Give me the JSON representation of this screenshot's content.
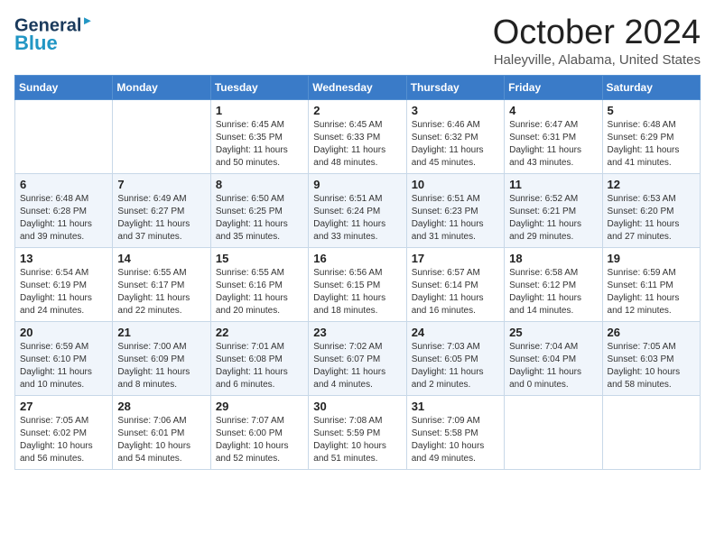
{
  "header": {
    "logo_line1": "General",
    "logo_line2": "Blue",
    "month_title": "October 2024",
    "location": "Haleyville, Alabama, United States"
  },
  "days_of_week": [
    "Sunday",
    "Monday",
    "Tuesday",
    "Wednesday",
    "Thursday",
    "Friday",
    "Saturday"
  ],
  "weeks": [
    [
      {
        "num": "",
        "sunrise": "",
        "sunset": "",
        "daylight": ""
      },
      {
        "num": "",
        "sunrise": "",
        "sunset": "",
        "daylight": ""
      },
      {
        "num": "1",
        "sunrise": "Sunrise: 6:45 AM",
        "sunset": "Sunset: 6:35 PM",
        "daylight": "Daylight: 11 hours and 50 minutes."
      },
      {
        "num": "2",
        "sunrise": "Sunrise: 6:45 AM",
        "sunset": "Sunset: 6:33 PM",
        "daylight": "Daylight: 11 hours and 48 minutes."
      },
      {
        "num": "3",
        "sunrise": "Sunrise: 6:46 AM",
        "sunset": "Sunset: 6:32 PM",
        "daylight": "Daylight: 11 hours and 45 minutes."
      },
      {
        "num": "4",
        "sunrise": "Sunrise: 6:47 AM",
        "sunset": "Sunset: 6:31 PM",
        "daylight": "Daylight: 11 hours and 43 minutes."
      },
      {
        "num": "5",
        "sunrise": "Sunrise: 6:48 AM",
        "sunset": "Sunset: 6:29 PM",
        "daylight": "Daylight: 11 hours and 41 minutes."
      }
    ],
    [
      {
        "num": "6",
        "sunrise": "Sunrise: 6:48 AM",
        "sunset": "Sunset: 6:28 PM",
        "daylight": "Daylight: 11 hours and 39 minutes."
      },
      {
        "num": "7",
        "sunrise": "Sunrise: 6:49 AM",
        "sunset": "Sunset: 6:27 PM",
        "daylight": "Daylight: 11 hours and 37 minutes."
      },
      {
        "num": "8",
        "sunrise": "Sunrise: 6:50 AM",
        "sunset": "Sunset: 6:25 PM",
        "daylight": "Daylight: 11 hours and 35 minutes."
      },
      {
        "num": "9",
        "sunrise": "Sunrise: 6:51 AM",
        "sunset": "Sunset: 6:24 PM",
        "daylight": "Daylight: 11 hours and 33 minutes."
      },
      {
        "num": "10",
        "sunrise": "Sunrise: 6:51 AM",
        "sunset": "Sunset: 6:23 PM",
        "daylight": "Daylight: 11 hours and 31 minutes."
      },
      {
        "num": "11",
        "sunrise": "Sunrise: 6:52 AM",
        "sunset": "Sunset: 6:21 PM",
        "daylight": "Daylight: 11 hours and 29 minutes."
      },
      {
        "num": "12",
        "sunrise": "Sunrise: 6:53 AM",
        "sunset": "Sunset: 6:20 PM",
        "daylight": "Daylight: 11 hours and 27 minutes."
      }
    ],
    [
      {
        "num": "13",
        "sunrise": "Sunrise: 6:54 AM",
        "sunset": "Sunset: 6:19 PM",
        "daylight": "Daylight: 11 hours and 24 minutes."
      },
      {
        "num": "14",
        "sunrise": "Sunrise: 6:55 AM",
        "sunset": "Sunset: 6:17 PM",
        "daylight": "Daylight: 11 hours and 22 minutes."
      },
      {
        "num": "15",
        "sunrise": "Sunrise: 6:55 AM",
        "sunset": "Sunset: 6:16 PM",
        "daylight": "Daylight: 11 hours and 20 minutes."
      },
      {
        "num": "16",
        "sunrise": "Sunrise: 6:56 AM",
        "sunset": "Sunset: 6:15 PM",
        "daylight": "Daylight: 11 hours and 18 minutes."
      },
      {
        "num": "17",
        "sunrise": "Sunrise: 6:57 AM",
        "sunset": "Sunset: 6:14 PM",
        "daylight": "Daylight: 11 hours and 16 minutes."
      },
      {
        "num": "18",
        "sunrise": "Sunrise: 6:58 AM",
        "sunset": "Sunset: 6:12 PM",
        "daylight": "Daylight: 11 hours and 14 minutes."
      },
      {
        "num": "19",
        "sunrise": "Sunrise: 6:59 AM",
        "sunset": "Sunset: 6:11 PM",
        "daylight": "Daylight: 11 hours and 12 minutes."
      }
    ],
    [
      {
        "num": "20",
        "sunrise": "Sunrise: 6:59 AM",
        "sunset": "Sunset: 6:10 PM",
        "daylight": "Daylight: 11 hours and 10 minutes."
      },
      {
        "num": "21",
        "sunrise": "Sunrise: 7:00 AM",
        "sunset": "Sunset: 6:09 PM",
        "daylight": "Daylight: 11 hours and 8 minutes."
      },
      {
        "num": "22",
        "sunrise": "Sunrise: 7:01 AM",
        "sunset": "Sunset: 6:08 PM",
        "daylight": "Daylight: 11 hours and 6 minutes."
      },
      {
        "num": "23",
        "sunrise": "Sunrise: 7:02 AM",
        "sunset": "Sunset: 6:07 PM",
        "daylight": "Daylight: 11 hours and 4 minutes."
      },
      {
        "num": "24",
        "sunrise": "Sunrise: 7:03 AM",
        "sunset": "Sunset: 6:05 PM",
        "daylight": "Daylight: 11 hours and 2 minutes."
      },
      {
        "num": "25",
        "sunrise": "Sunrise: 7:04 AM",
        "sunset": "Sunset: 6:04 PM",
        "daylight": "Daylight: 11 hours and 0 minutes."
      },
      {
        "num": "26",
        "sunrise": "Sunrise: 7:05 AM",
        "sunset": "Sunset: 6:03 PM",
        "daylight": "Daylight: 10 hours and 58 minutes."
      }
    ],
    [
      {
        "num": "27",
        "sunrise": "Sunrise: 7:05 AM",
        "sunset": "Sunset: 6:02 PM",
        "daylight": "Daylight: 10 hours and 56 minutes."
      },
      {
        "num": "28",
        "sunrise": "Sunrise: 7:06 AM",
        "sunset": "Sunset: 6:01 PM",
        "daylight": "Daylight: 10 hours and 54 minutes."
      },
      {
        "num": "29",
        "sunrise": "Sunrise: 7:07 AM",
        "sunset": "Sunset: 6:00 PM",
        "daylight": "Daylight: 10 hours and 52 minutes."
      },
      {
        "num": "30",
        "sunrise": "Sunrise: 7:08 AM",
        "sunset": "Sunset: 5:59 PM",
        "daylight": "Daylight: 10 hours and 51 minutes."
      },
      {
        "num": "31",
        "sunrise": "Sunrise: 7:09 AM",
        "sunset": "Sunset: 5:58 PM",
        "daylight": "Daylight: 10 hours and 49 minutes."
      },
      {
        "num": "",
        "sunrise": "",
        "sunset": "",
        "daylight": ""
      },
      {
        "num": "",
        "sunrise": "",
        "sunset": "",
        "daylight": ""
      }
    ]
  ]
}
